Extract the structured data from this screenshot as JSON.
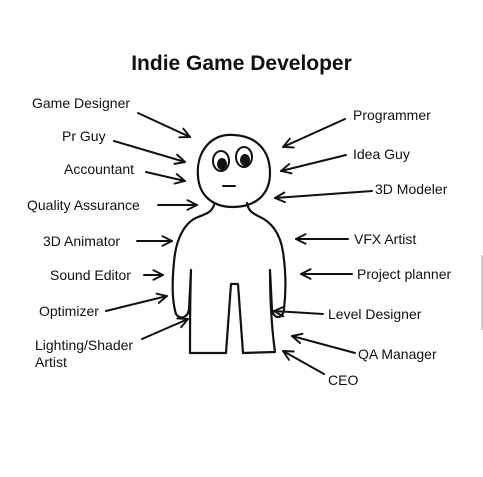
{
  "title": "Indie Game Developer",
  "roles_left": [
    "Game Designer",
    "Pr Guy",
    "Accountant",
    "Quality Assurance",
    "3D Animator",
    "Sound Editor",
    "Optimizer",
    "Lighting/Shader Artist"
  ],
  "roles_right": [
    "Programmer",
    "Idea Guy",
    "3D Modeler",
    "VFX Artist",
    "Project planner",
    "Level Designer",
    "QA Manager",
    "CEO"
  ],
  "ink_color": "#111111",
  "background": "#ffffff"
}
